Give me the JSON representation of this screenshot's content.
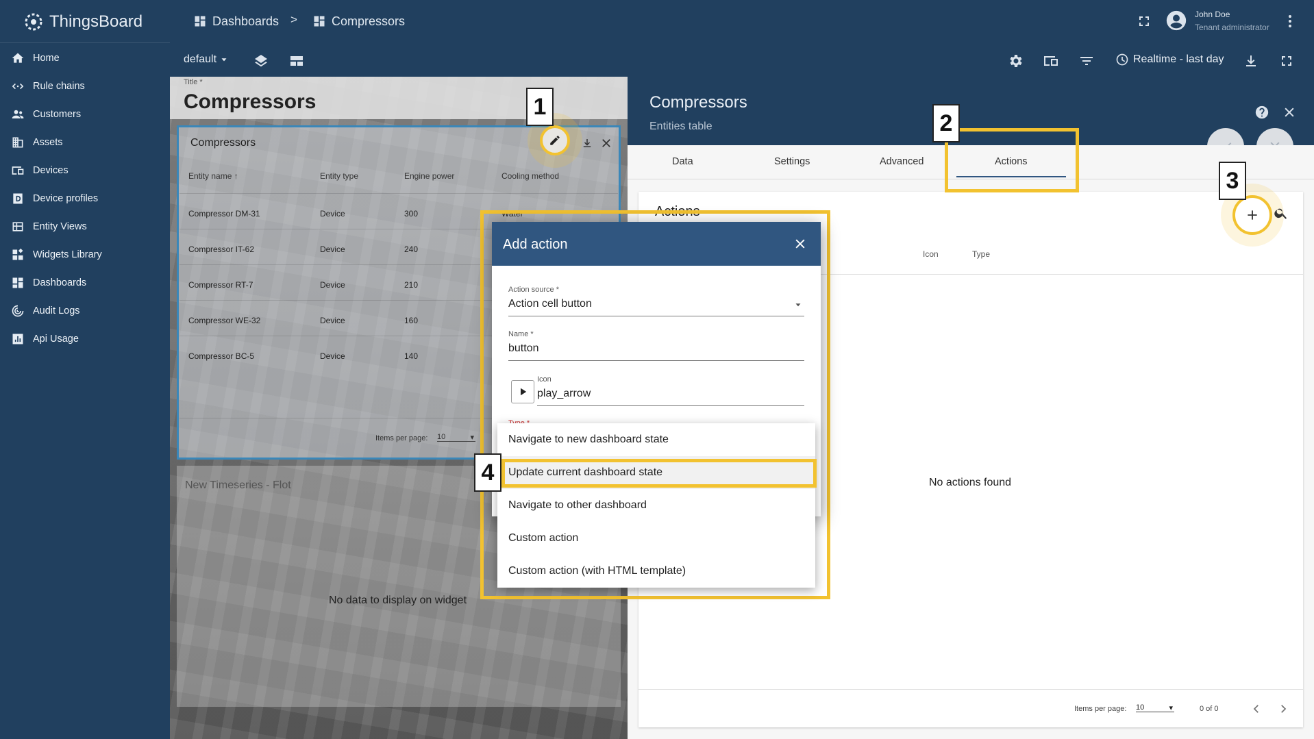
{
  "app": {
    "name": "ThingsBoard"
  },
  "breadcrumb": {
    "dashboards": "Dashboards",
    "separator": ">",
    "current": "Compressors"
  },
  "user": {
    "name": "John Doe",
    "role": "Tenant administrator"
  },
  "sidebar": {
    "items": [
      {
        "label": "Home",
        "icon": "home-icon"
      },
      {
        "label": "Rule chains",
        "icon": "rule-chains-icon"
      },
      {
        "label": "Customers",
        "icon": "customers-icon"
      },
      {
        "label": "Assets",
        "icon": "assets-icon"
      },
      {
        "label": "Devices",
        "icon": "devices-icon"
      },
      {
        "label": "Device profiles",
        "icon": "device-profiles-icon"
      },
      {
        "label": "Entity Views",
        "icon": "entity-views-icon"
      },
      {
        "label": "Widgets Library",
        "icon": "widgets-library-icon"
      },
      {
        "label": "Dashboards",
        "icon": "dashboards-icon"
      },
      {
        "label": "Audit Logs",
        "icon": "audit-logs-icon"
      },
      {
        "label": "Api Usage",
        "icon": "api-usage-icon"
      }
    ]
  },
  "toolbar": {
    "state": "default",
    "realtime": "Realtime - last day"
  },
  "dashboard": {
    "title_label": "Title *",
    "title_value": "Compressors",
    "widget": {
      "title": "Compressors",
      "columns": [
        "Entity name",
        "Entity type",
        "Engine power",
        "Cooling method"
      ],
      "rows": [
        [
          "Compressor DM-31",
          "Device",
          "300",
          "Water"
        ],
        [
          "Compressor IT-62",
          "Device",
          "240",
          ""
        ],
        [
          "Compressor RT-7",
          "Device",
          "210",
          ""
        ],
        [
          "Compressor WE-32",
          "Device",
          "160",
          ""
        ],
        [
          "Compressor BC-5",
          "Device",
          "140",
          ""
        ]
      ],
      "items_per_page_label": "Items per page:",
      "items_per_page": "10"
    },
    "timeseries": {
      "title": "New Timeseries - Flot",
      "no_data": "No data to display on widget"
    }
  },
  "panel": {
    "title": "Compressors",
    "subtitle": "Entities table",
    "tabs": [
      "Data",
      "Settings",
      "Advanced",
      "Actions"
    ],
    "active_tab": "Actions",
    "actions_heading": "Actions",
    "table_headers": [
      "Icon",
      "Type"
    ],
    "empty": "No actions found",
    "footer": {
      "items_per_page_label": "Items per page:",
      "items_per_page": "10",
      "range": "0 of 0"
    }
  },
  "dialog": {
    "title": "Add action",
    "action_source_label": "Action source *",
    "action_source": "Action cell button",
    "name_label": "Name *",
    "name": "button",
    "icon_label": "Icon",
    "icon_value": "play_arrow",
    "type_label": "Type *"
  },
  "dropdown": {
    "options": [
      "Navigate to new dashboard state",
      "Update current dashboard state",
      "Navigate to other dashboard",
      "Custom action",
      "Custom action (with HTML template)"
    ],
    "highlighted": "Update current dashboard state"
  },
  "annotations": {
    "n1": "1",
    "n2": "2",
    "n3": "3",
    "n4": "4"
  },
  "colors": {
    "nav": "#21405f",
    "accent": "#305680",
    "highlight": "#f2c230"
  }
}
